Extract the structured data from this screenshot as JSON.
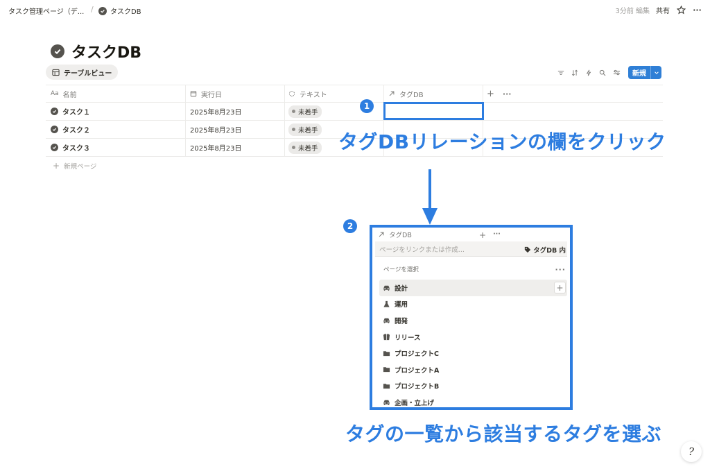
{
  "breadcrumb": {
    "parent": "タスク管理ページ（デ...",
    "separator": "/",
    "current": "タスクDB"
  },
  "topbar": {
    "edited": "3分前 編集",
    "share": "共有"
  },
  "page": {
    "title": "タスクDB",
    "view_tab": "テーブルビュー",
    "new_button": "新規"
  },
  "table": {
    "columns": [
      {
        "icon": "Aa",
        "label": "名前"
      },
      {
        "icon": "calendar-icon",
        "label": "実行日"
      },
      {
        "icon": "status-icon",
        "label": "テキスト"
      },
      {
        "icon": "relation-arrow-icon",
        "label": "タグDB"
      }
    ],
    "rows": [
      {
        "name": "タスク１",
        "date": "2025年8月23日",
        "status": "未着手"
      },
      {
        "name": "タスク２",
        "date": "2025年8月23日",
        "status": "未着手"
      },
      {
        "name": "タスク３",
        "date": "2025年8月23日",
        "status": "未着手"
      }
    ],
    "new_page": "新規ページ",
    "add_column": "+",
    "more": "···"
  },
  "annotations": {
    "step1_number": "1",
    "step1_text": "タグDBリレーションの欄をクリック",
    "step2_number": "2",
    "step2_text": "タグの一覧から該当するタグを選ぶ",
    "accent_color": "#2d7de0"
  },
  "popup": {
    "header": "タグDB",
    "search_placeholder": "ページをリンクまたは作成...",
    "scope": "タグDB 内",
    "section_label": "ページを選択",
    "items": [
      {
        "label": "設計",
        "icon": "car-icon"
      },
      {
        "label": "運用",
        "icon": "flask-icon"
      },
      {
        "label": "開発",
        "icon": "car-icon"
      },
      {
        "label": "リリース",
        "icon": "jacket-icon"
      },
      {
        "label": "プロジェクトC",
        "icon": "folder-icon"
      },
      {
        "label": "プロジェクトA",
        "icon": "folder-icon"
      },
      {
        "label": "プロジェクトB",
        "icon": "folder-icon"
      },
      {
        "label": "企画・立上げ",
        "icon": "car-icon"
      }
    ]
  }
}
